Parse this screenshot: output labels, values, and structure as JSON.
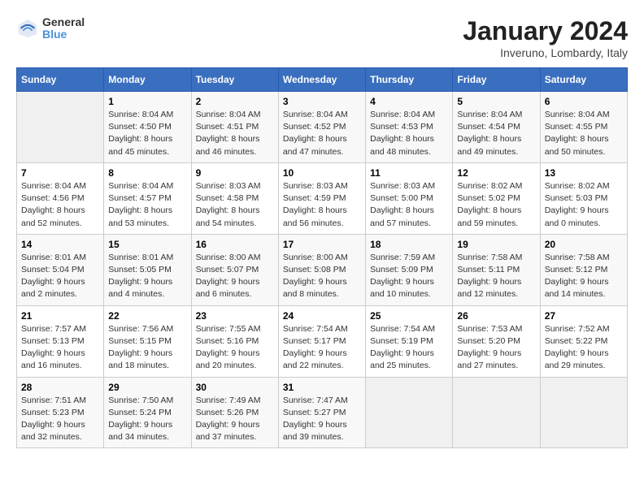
{
  "logo": {
    "line1": "General",
    "line2": "Blue"
  },
  "title": "January 2024",
  "subtitle": "Inveruno, Lombardy, Italy",
  "headers": [
    "Sunday",
    "Monday",
    "Tuesday",
    "Wednesday",
    "Thursday",
    "Friday",
    "Saturday"
  ],
  "weeks": [
    [
      {
        "num": "",
        "info": ""
      },
      {
        "num": "1",
        "info": "Sunrise: 8:04 AM\nSunset: 4:50 PM\nDaylight: 8 hours\nand 45 minutes."
      },
      {
        "num": "2",
        "info": "Sunrise: 8:04 AM\nSunset: 4:51 PM\nDaylight: 8 hours\nand 46 minutes."
      },
      {
        "num": "3",
        "info": "Sunrise: 8:04 AM\nSunset: 4:52 PM\nDaylight: 8 hours\nand 47 minutes."
      },
      {
        "num": "4",
        "info": "Sunrise: 8:04 AM\nSunset: 4:53 PM\nDaylight: 8 hours\nand 48 minutes."
      },
      {
        "num": "5",
        "info": "Sunrise: 8:04 AM\nSunset: 4:54 PM\nDaylight: 8 hours\nand 49 minutes."
      },
      {
        "num": "6",
        "info": "Sunrise: 8:04 AM\nSunset: 4:55 PM\nDaylight: 8 hours\nand 50 minutes."
      }
    ],
    [
      {
        "num": "7",
        "info": "Sunrise: 8:04 AM\nSunset: 4:56 PM\nDaylight: 8 hours\nand 52 minutes."
      },
      {
        "num": "8",
        "info": "Sunrise: 8:04 AM\nSunset: 4:57 PM\nDaylight: 8 hours\nand 53 minutes."
      },
      {
        "num": "9",
        "info": "Sunrise: 8:03 AM\nSunset: 4:58 PM\nDaylight: 8 hours\nand 54 minutes."
      },
      {
        "num": "10",
        "info": "Sunrise: 8:03 AM\nSunset: 4:59 PM\nDaylight: 8 hours\nand 56 minutes."
      },
      {
        "num": "11",
        "info": "Sunrise: 8:03 AM\nSunset: 5:00 PM\nDaylight: 8 hours\nand 57 minutes."
      },
      {
        "num": "12",
        "info": "Sunrise: 8:02 AM\nSunset: 5:02 PM\nDaylight: 8 hours\nand 59 minutes."
      },
      {
        "num": "13",
        "info": "Sunrise: 8:02 AM\nSunset: 5:03 PM\nDaylight: 9 hours\nand 0 minutes."
      }
    ],
    [
      {
        "num": "14",
        "info": "Sunrise: 8:01 AM\nSunset: 5:04 PM\nDaylight: 9 hours\nand 2 minutes."
      },
      {
        "num": "15",
        "info": "Sunrise: 8:01 AM\nSunset: 5:05 PM\nDaylight: 9 hours\nand 4 minutes."
      },
      {
        "num": "16",
        "info": "Sunrise: 8:00 AM\nSunset: 5:07 PM\nDaylight: 9 hours\nand 6 minutes."
      },
      {
        "num": "17",
        "info": "Sunrise: 8:00 AM\nSunset: 5:08 PM\nDaylight: 9 hours\nand 8 minutes."
      },
      {
        "num": "18",
        "info": "Sunrise: 7:59 AM\nSunset: 5:09 PM\nDaylight: 9 hours\nand 10 minutes."
      },
      {
        "num": "19",
        "info": "Sunrise: 7:58 AM\nSunset: 5:11 PM\nDaylight: 9 hours\nand 12 minutes."
      },
      {
        "num": "20",
        "info": "Sunrise: 7:58 AM\nSunset: 5:12 PM\nDaylight: 9 hours\nand 14 minutes."
      }
    ],
    [
      {
        "num": "21",
        "info": "Sunrise: 7:57 AM\nSunset: 5:13 PM\nDaylight: 9 hours\nand 16 minutes."
      },
      {
        "num": "22",
        "info": "Sunrise: 7:56 AM\nSunset: 5:15 PM\nDaylight: 9 hours\nand 18 minutes."
      },
      {
        "num": "23",
        "info": "Sunrise: 7:55 AM\nSunset: 5:16 PM\nDaylight: 9 hours\nand 20 minutes."
      },
      {
        "num": "24",
        "info": "Sunrise: 7:54 AM\nSunset: 5:17 PM\nDaylight: 9 hours\nand 22 minutes."
      },
      {
        "num": "25",
        "info": "Sunrise: 7:54 AM\nSunset: 5:19 PM\nDaylight: 9 hours\nand 25 minutes."
      },
      {
        "num": "26",
        "info": "Sunrise: 7:53 AM\nSunset: 5:20 PM\nDaylight: 9 hours\nand 27 minutes."
      },
      {
        "num": "27",
        "info": "Sunrise: 7:52 AM\nSunset: 5:22 PM\nDaylight: 9 hours\nand 29 minutes."
      }
    ],
    [
      {
        "num": "28",
        "info": "Sunrise: 7:51 AM\nSunset: 5:23 PM\nDaylight: 9 hours\nand 32 minutes."
      },
      {
        "num": "29",
        "info": "Sunrise: 7:50 AM\nSunset: 5:24 PM\nDaylight: 9 hours\nand 34 minutes."
      },
      {
        "num": "30",
        "info": "Sunrise: 7:49 AM\nSunset: 5:26 PM\nDaylight: 9 hours\nand 37 minutes."
      },
      {
        "num": "31",
        "info": "Sunrise: 7:47 AM\nSunset: 5:27 PM\nDaylight: 9 hours\nand 39 minutes."
      },
      {
        "num": "",
        "info": ""
      },
      {
        "num": "",
        "info": ""
      },
      {
        "num": "",
        "info": ""
      }
    ]
  ]
}
